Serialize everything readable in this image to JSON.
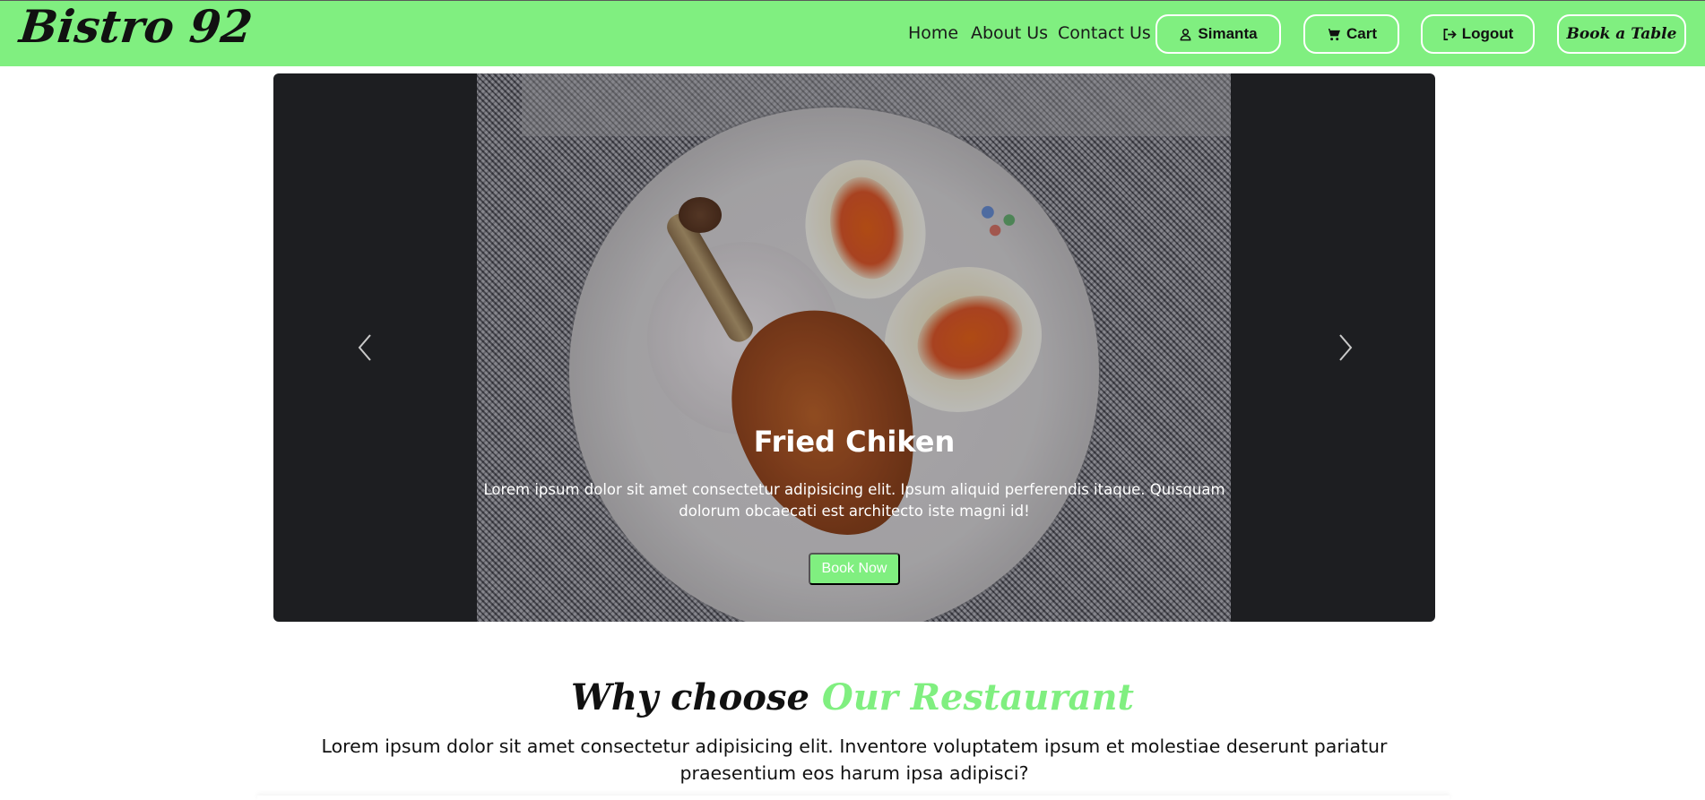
{
  "navbar": {
    "brand": "Bistro 92",
    "links": {
      "home": "Home",
      "about": "About Us",
      "contact": "Contact Us"
    },
    "user_button": "Simanta",
    "cart_button": "Cart",
    "logout_button": "Logout",
    "book_button": "Book a Table",
    "background_color": "#80ef80"
  },
  "carousel": {
    "slide": {
      "title": "Fried Chiken",
      "text": "Lorem ipsum dolor sit amet consectetur adipisicing elit. Ipsum aliquid perferendis itaque. Quisquam dolorum obcaecati est architecto iste magni id!",
      "button": "Book Now",
      "image": "fried-chicken-plate-photo"
    },
    "prev_icon": "chevron-left-icon",
    "next_icon": "chevron-right-icon"
  },
  "why": {
    "title_part1": "Why choose",
    "title_part2": "Our Restaurant",
    "text": "Lorem ipsum dolor sit amet consectetur adipisicing elit. Inventore voluptatem ipsum et molestiae deserunt pariatur praesentium eos harum ipsa adipisci?",
    "accent_color": "#80ef80"
  }
}
